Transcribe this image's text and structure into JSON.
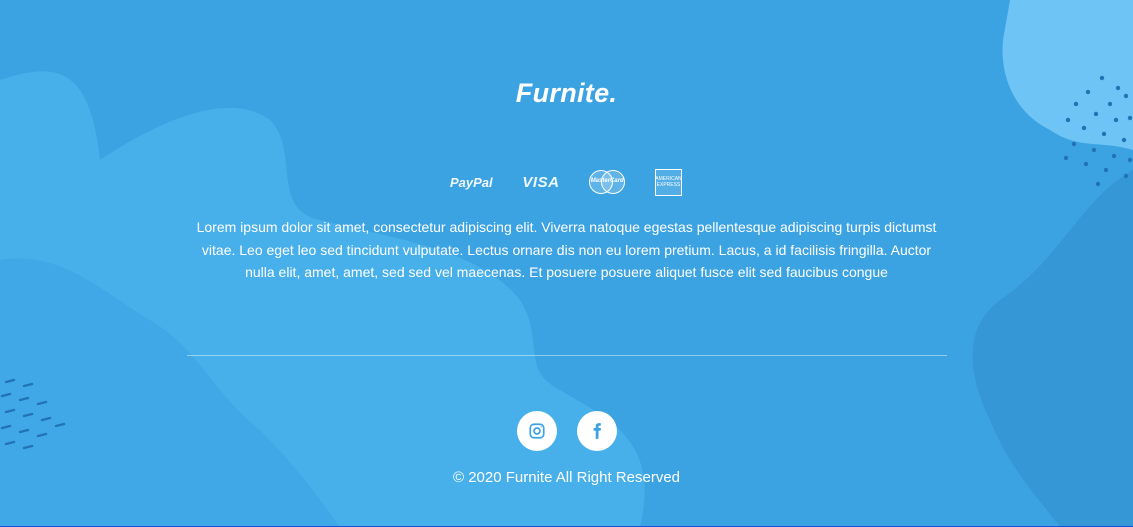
{
  "brand": {
    "name": "Furnite."
  },
  "payments": {
    "paypal": "PayPal",
    "visa": "VISA",
    "mastercard": "MasterCard",
    "amex_line1": "AMERICAN",
    "amex_line2": "EXPRESS"
  },
  "description": "Lorem ipsum dolor sit amet, consectetur adipiscing elit. Viverra natoque egestas pellentesque adipiscing turpis dictumst vitae. Leo eget leo sed tincidunt vulputate. Lectus ornare dis non eu lorem pretium. Lacus, a id facilisis fringilla. Auctor nulla elit, amet, amet, sed sed vel maecenas. Et posuere posuere aliquet fusce elit sed faucibus congue",
  "social": {
    "items": [
      {
        "icon": "instagram-icon"
      },
      {
        "icon": "facebook-icon"
      }
    ]
  },
  "copyright": "© 2020 Furnite All Right Reserved",
  "colors": {
    "background": "#3ca3e2",
    "blob_light": "#47b0ea",
    "blob_dark": "#3597d6",
    "accent_light": "#6ec4f4",
    "icon_blue": "#3ca3e2"
  }
}
